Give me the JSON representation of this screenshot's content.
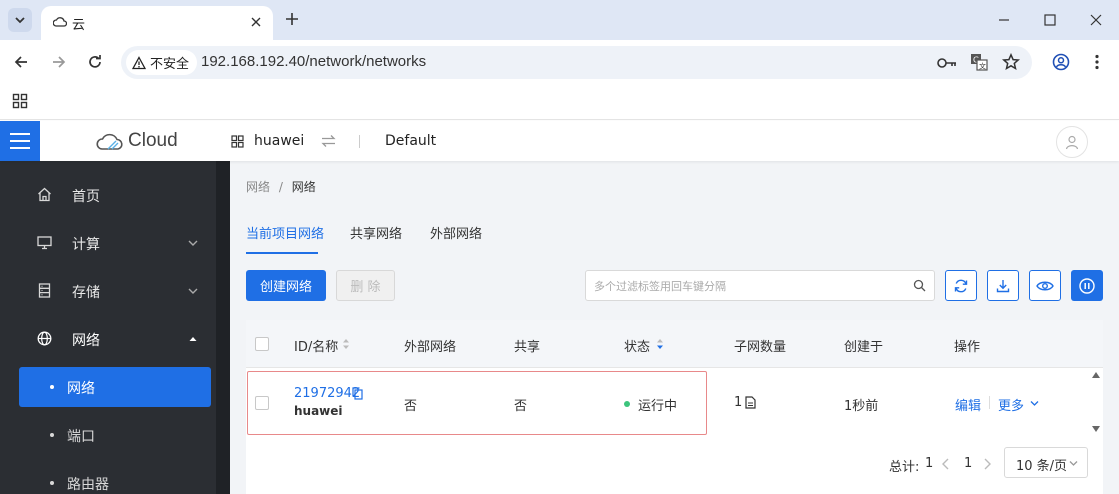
{
  "browser": {
    "tab_title": "云",
    "security_label": "不安全",
    "url": "192.168.192.40/network/networks"
  },
  "header": {
    "logo_text": "Cloud",
    "project": "huawei",
    "domain": "Default"
  },
  "sidebar": {
    "items": [
      {
        "label": "首页",
        "icon": "home-icon"
      },
      {
        "label": "计算",
        "icon": "monitor-icon"
      },
      {
        "label": "存储",
        "icon": "storage-icon"
      },
      {
        "label": "网络",
        "icon": "globe-icon"
      }
    ],
    "sub_items": [
      {
        "label": "网络",
        "active": true
      },
      {
        "label": "端口",
        "active": false
      },
      {
        "label": "路由器",
        "active": false
      }
    ]
  },
  "main": {
    "breadcrumb": {
      "parent": "网络",
      "sep": "/",
      "current": "网络"
    },
    "tabs": [
      "当前项目网络",
      "共享网络",
      "外部网络"
    ],
    "create_label": "创建网络",
    "delete_label": "删 除",
    "search_placeholder": "多个过滤标签用回车键分隔",
    "table": {
      "headers": [
        "ID/名称",
        "外部网络",
        "共享",
        "状态",
        "子网数量",
        "创建于",
        "操作"
      ],
      "rows": [
        {
          "id": "21972942",
          "name": "huawei",
          "external": "否",
          "shared": "否",
          "status": "运行中",
          "subnets": "1",
          "created": "1秒前",
          "edit": "编辑",
          "more": "更多"
        }
      ]
    },
    "pagination": {
      "total_label": "总计:",
      "total": "1",
      "current_page": "1",
      "page_size": "10 条/页"
    }
  },
  "colors": {
    "accent": "#1f6fe5",
    "sidebar_bg": "#2b2e33",
    "status_running": "#3cc47c",
    "highlight_border": "#e8898a"
  }
}
